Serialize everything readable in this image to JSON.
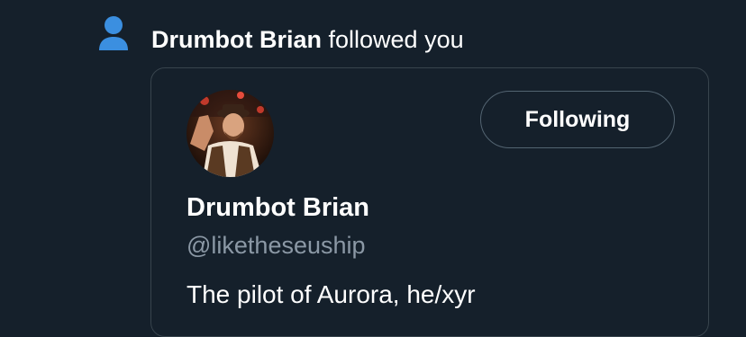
{
  "notification": {
    "actor_name": "Drumbot Brian",
    "action_text": " followed you",
    "icon": "person-icon",
    "icon_color": "#3b8fe0"
  },
  "user_card": {
    "avatar": "avatar",
    "display_name": "Drumbot Brian",
    "handle": "@liketheseuship",
    "bio": "The pilot of Aurora, he/xyr",
    "follow_button_label": "Following"
  },
  "colors": {
    "background": "#15202b",
    "border": "#38444d",
    "secondary_text": "#8b98a5",
    "primary_text": "#ffffff"
  }
}
